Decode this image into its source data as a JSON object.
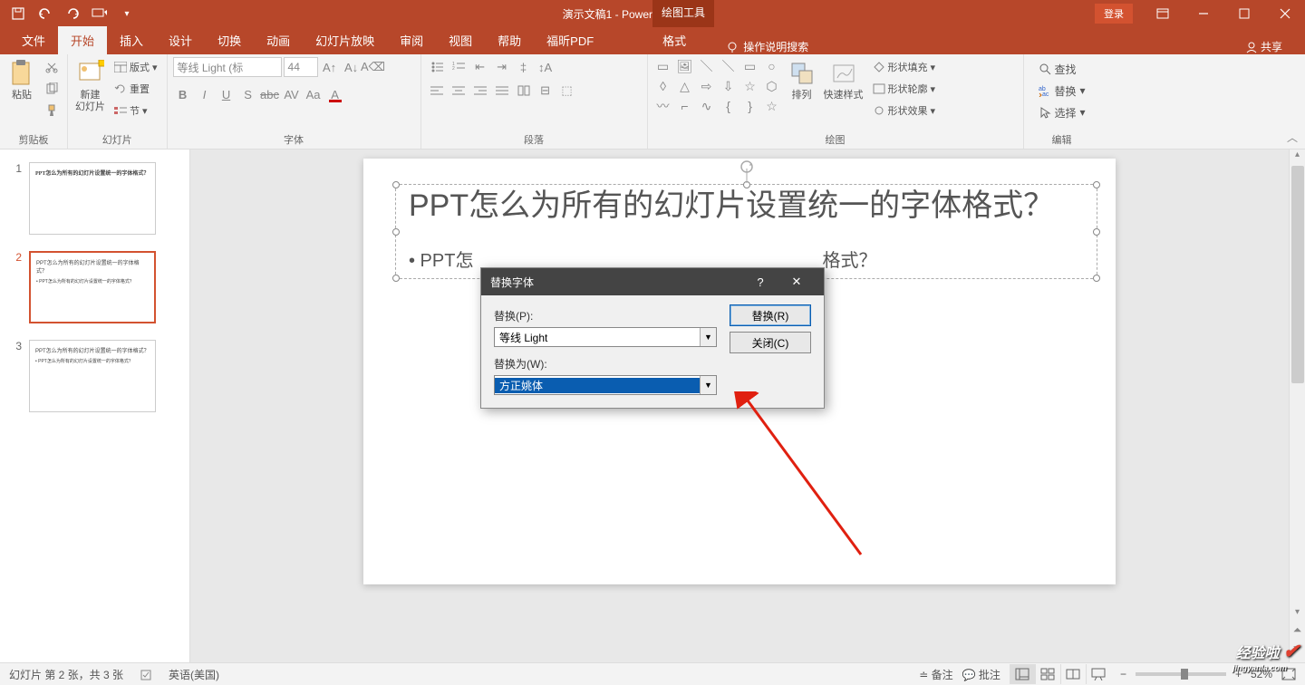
{
  "title_bar": {
    "doc_title": "演示文稿1 - PowerPoint",
    "drawing_tools": "绘图工具",
    "login": "登录"
  },
  "tabs": {
    "file": "文件",
    "home": "开始",
    "insert": "插入",
    "design": "设计",
    "transition": "切换",
    "animation": "动画",
    "slideshow": "幻灯片放映",
    "review": "审阅",
    "view": "视图",
    "help": "帮助",
    "foxit": "福昕PDF",
    "format": "格式",
    "search_hint": "操作说明搜索",
    "share": "共享"
  },
  "ribbon": {
    "clipboard": {
      "paste": "粘贴",
      "label": "剪贴板"
    },
    "slides": {
      "new_slide": "新建\n幻灯片",
      "layout": "版式",
      "reset": "重置",
      "section": "节",
      "label": "幻灯片"
    },
    "font": {
      "name": "等线 Light (标",
      "size": "44",
      "label": "字体"
    },
    "paragraph": {
      "label": "段落"
    },
    "drawing": {
      "arrange": "排列",
      "quick_style": "快速样式",
      "shape_fill": "形状填充",
      "shape_outline": "形状轮廓",
      "shape_effects": "形状效果",
      "label": "绘图"
    },
    "editing": {
      "find": "查找",
      "replace": "替换",
      "select": "选择",
      "label": "编辑"
    }
  },
  "thumbnails": {
    "items": [
      {
        "num": "1",
        "title": "PPT怎么为所有的幻灯片设置统一的字体格式？"
      },
      {
        "num": "2",
        "title": "PPT怎么为所有的幻灯片设置统一的字体格式？",
        "body": "• PPT怎么为所有的幻灯片设置统一的字体格式？"
      },
      {
        "num": "3",
        "title": "PPT怎么为所有的幻灯片设置统一的字体格式？",
        "body": "• PPT怎么为所有的幻灯片设置统一的字体格式？"
      }
    ]
  },
  "slide": {
    "title": "PPT怎么为所有的幻灯片设置统一的字体格式？",
    "bullet": "• PPT怎",
    "bullet_after": "格式？"
  },
  "dialog": {
    "title": "替换字体",
    "replace_label": "替换(P):",
    "replace_value": "等线 Light",
    "replace_with_label": "替换为(W):",
    "replace_with_value": "方正姚体",
    "replace_btn": "替换(R)",
    "close_btn": "关闭(C)"
  },
  "status": {
    "slide_info": "幻灯片 第 2 张，共 3 张",
    "lang": "英语(美国)",
    "notes": "备注",
    "comments": "批注",
    "zoom": "52%"
  },
  "watermark": {
    "text": "经验啦",
    "url": "jingyanla.com"
  }
}
